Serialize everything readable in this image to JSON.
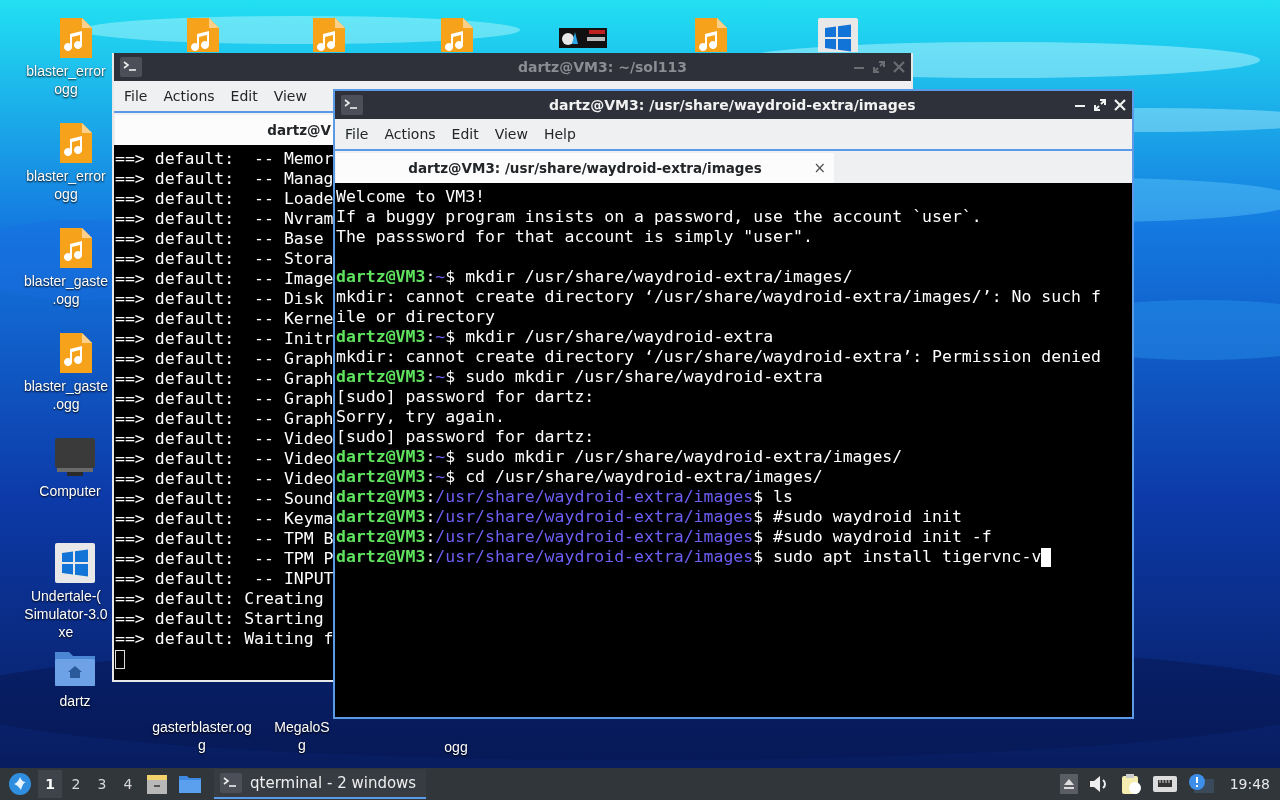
{
  "desktop_icons": [
    {
      "kind": "audio",
      "label": [
        "blaster_error",
        "ogg"
      ]
    },
    {
      "kind": "audio",
      "label": [
        "blaster_error",
        "ogg"
      ]
    },
    {
      "kind": "audio",
      "label": [
        "blaster_gaste",
        ".ogg"
      ]
    },
    {
      "kind": "audio",
      "label": [
        "blaster_gaste",
        ".ogg"
      ]
    },
    {
      "kind": "computer",
      "label": [
        "Computer"
      ]
    },
    {
      "kind": "windows",
      "label": [
        "Undertale-(",
        "Simulator-3.0",
        "xe"
      ]
    },
    {
      "kind": "home",
      "label": [
        "dartz"
      ]
    },
    {
      "kind": "audio"
    },
    {
      "kind": "audio"
    },
    {
      "kind": "audio"
    },
    {
      "kind": "thumbnail"
    },
    {
      "kind": "audio"
    },
    {
      "kind": "windows"
    },
    {
      "label": [
        "gasterblaster.og",
        "g"
      ]
    },
    {
      "label": [
        "MegaloS",
        "g"
      ]
    },
    {
      "label": [
        "ogg"
      ]
    }
  ],
  "windows": [
    {
      "title": "dartz@VM3: ~/sol113",
      "active": false,
      "menu": [
        "File",
        "Actions",
        "Edit",
        "View"
      ],
      "tabs": [
        {
          "label": "dartz@V",
          "selected": true
        }
      ],
      "lines": [
        {
          "kind": "output",
          "text": "==> default:  -- Memor"
        },
        {
          "kind": "output",
          "text": "==> default:  -- Manag"
        },
        {
          "kind": "output",
          "text": "==> default:  -- Loade"
        },
        {
          "kind": "output",
          "text": "==> default:  -- Nvram"
        },
        {
          "kind": "output",
          "text": "==> default:  -- Base"
        },
        {
          "kind": "output",
          "text": "==> default:  -- Stora"
        },
        {
          "kind": "output",
          "text": "==> default:  -- Image"
        },
        {
          "kind": "output",
          "text": "==> default:  -- Disk"
        },
        {
          "kind": "output",
          "text": "==> default:  -- Kerne"
        },
        {
          "kind": "output",
          "text": "==> default:  -- Initr"
        },
        {
          "kind": "output",
          "text": "==> default:  -- Graph"
        },
        {
          "kind": "output",
          "text": "==> default:  -- Graph"
        },
        {
          "kind": "output",
          "text": "==> default:  -- Graph"
        },
        {
          "kind": "output",
          "text": "==> default:  -- Graph"
        },
        {
          "kind": "output",
          "text": "==> default:  -- Video"
        },
        {
          "kind": "output",
          "text": "==> default:  -- Video"
        },
        {
          "kind": "output",
          "text": "==> default:  -- Video"
        },
        {
          "kind": "output",
          "text": "==> default:  -- Sound"
        },
        {
          "kind": "output",
          "text": "==> default:  -- Keyma"
        },
        {
          "kind": "output",
          "text": "==> default:  -- TPM B"
        },
        {
          "kind": "output",
          "text": "==> default:  -- TPM P"
        },
        {
          "kind": "output",
          "text": "==> default:  -- INPUT"
        },
        {
          "kind": "output",
          "text": "==> default: Creating"
        },
        {
          "kind": "output",
          "text": "==> default: Starting"
        },
        {
          "kind": "output",
          "text": "==> default: Waiting f"
        },
        {
          "kind": "blank"
        }
      ]
    },
    {
      "title": "dartz@VM3: /usr/share/waydroid-extra/images",
      "active": true,
      "menu": [
        "File",
        "Actions",
        "Edit",
        "View",
        "Help"
      ],
      "tabs": [
        {
          "label": "dartz@VM3: /usr/share/waydroid-extra/images",
          "selected": true,
          "close": "×"
        }
      ],
      "lines": [
        {
          "kind": "output",
          "text": "Welcome to VM3!"
        },
        {
          "kind": "output",
          "text": "If a buggy program insists on a password, use the account `user`."
        },
        {
          "kind": "output",
          "text": "The passsword for that account is simply \"user\"."
        },
        {
          "kind": "blank"
        },
        {
          "kind": "prompt",
          "user": "dartz@VM3",
          "colon": ":",
          "path": "~",
          "command": "$ mkdir /usr/share/waydroid-extra/images/"
        },
        {
          "kind": "output",
          "text": "mkdir: cannot create directory ‘/usr/share/waydroid-extra/images/’: No such f"
        },
        {
          "kind": "output",
          "text": "ile or directory"
        },
        {
          "kind": "prompt",
          "user": "dartz@VM3",
          "colon": ":",
          "path": "~",
          "command": "$ mkdir /usr/share/waydroid-extra"
        },
        {
          "kind": "output",
          "text": "mkdir: cannot create directory ‘/usr/share/waydroid-extra’: Permission denied"
        },
        {
          "kind": "prompt",
          "user": "dartz@VM3",
          "colon": ":",
          "path": "~",
          "command": "$ sudo mkdir /usr/share/waydroid-extra"
        },
        {
          "kind": "output",
          "text": "[sudo] password for dartz:"
        },
        {
          "kind": "output",
          "text": "Sorry, try again."
        },
        {
          "kind": "output",
          "text": "[sudo] password for dartz:"
        },
        {
          "kind": "prompt",
          "user": "dartz@VM3",
          "colon": ":",
          "path": "~",
          "command": "$ sudo mkdir /usr/share/waydroid-extra/images/"
        },
        {
          "kind": "prompt",
          "user": "dartz@VM3",
          "colon": ":",
          "path": "~",
          "command": "$ cd /usr/share/waydroid-extra/images/"
        },
        {
          "kind": "prompt",
          "user": "dartz@VM3",
          "colon": ":",
          "path": "/usr/share/waydroid-extra/images",
          "command": "$ ls"
        },
        {
          "kind": "prompt",
          "user": "dartz@VM3",
          "colon": ":",
          "path": "/usr/share/waydroid-extra/images",
          "command": "$ #sudo waydroid init"
        },
        {
          "kind": "prompt",
          "user": "dartz@VM3",
          "colon": ":",
          "path": "/usr/share/waydroid-extra/images",
          "command": "$ #sudo waydroid init -f"
        },
        {
          "kind": "prompt",
          "user": "dartz@VM3",
          "colon": ":",
          "path": "/usr/share/waydroid-extra/images",
          "command": "$ sudo apt install tigervnc-v"
        }
      ]
    }
  ],
  "taskbar": {
    "desktops": [
      {
        "label": "1",
        "selected": true
      },
      {
        "label": "2",
        "selected": false
      },
      {
        "label": "3",
        "selected": false
      },
      {
        "label": "4",
        "selected": false
      }
    ],
    "tasks": [
      {
        "label": "qterminal - 2 windows",
        "selected": true
      }
    ],
    "clock": "19:48"
  }
}
